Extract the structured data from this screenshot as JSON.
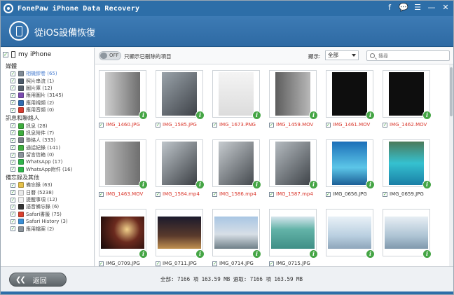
{
  "window": {
    "title": "FonePaw iPhone Data Recovery",
    "title_icons": [
      "facebook-icon",
      "chat-icon",
      "menu-icon",
      "minimize-icon",
      "close-icon"
    ]
  },
  "header": {
    "title": "從iOS設備恢復"
  },
  "sidebar": {
    "device": "my iPhone",
    "groups": [
      {
        "title": "媒體",
        "items": [
          {
            "label": "相機膠卷 (65)",
            "icon": "camera-roll-icon",
            "color": "#7f8a95",
            "active": true
          },
          {
            "label": "照片串流 (1)",
            "icon": "photo-stream-icon",
            "color": "#4b5a6a",
            "active": false
          },
          {
            "label": "圖片庫 (12)",
            "icon": "photo-library-icon",
            "color": "#555f6b",
            "active": false
          },
          {
            "label": "應用圖片 (3145)",
            "icon": "app-photos-icon",
            "color": "#7b4bb0",
            "active": false
          },
          {
            "label": "應用視頻 (2)",
            "icon": "app-videos-icon",
            "color": "#2f6bb0",
            "active": false
          },
          {
            "label": "應用音頻 (0)",
            "icon": "app-audio-icon",
            "color": "#d63b2f",
            "active": false
          }
        ]
      },
      {
        "title": "訊息和聯絡人",
        "items": [
          {
            "label": "訊息 (28)",
            "icon": "messages-icon",
            "color": "#3fae3f",
            "active": false
          },
          {
            "label": "訊息附件 (7)",
            "icon": "message-attachments-icon",
            "color": "#3fae3f",
            "active": false
          },
          {
            "label": "聯絡人 (333)",
            "icon": "contacts-icon",
            "color": "#777f87",
            "active": false
          },
          {
            "label": "通話紀錄 (141)",
            "icon": "call-history-icon",
            "color": "#3fae3f",
            "active": false
          },
          {
            "label": "留言信箱 (0)",
            "icon": "voicemail-icon",
            "color": "#8a939b",
            "active": false
          },
          {
            "label": "WhatsApp (17)",
            "icon": "whatsapp-icon",
            "color": "#2fb54b",
            "active": false
          },
          {
            "label": "WhatsApp附件 (16)",
            "icon": "whatsapp-attachments-icon",
            "color": "#2fb54b",
            "active": false
          }
        ]
      },
      {
        "title": "備忘錄及其他",
        "items": [
          {
            "label": "備忘錄 (63)",
            "icon": "notes-icon",
            "color": "#e6c14a",
            "active": false
          },
          {
            "label": "日曆 (5238)",
            "icon": "calendar-icon",
            "color": "#e9e9e9",
            "active": false
          },
          {
            "label": "提醒事項 (12)",
            "icon": "reminders-icon",
            "color": "#f0f0f0",
            "active": false
          },
          {
            "label": "語音備忘錄 (6)",
            "icon": "voice-memos-icon",
            "color": "#333333",
            "active": false
          },
          {
            "label": "Safari書籤 (75)",
            "icon": "safari-bookmark-icon",
            "color": "#d9412f",
            "active": false
          },
          {
            "label": "Safari History (3)",
            "icon": "safari-history-icon",
            "color": "#3a8fd6",
            "active": false
          },
          {
            "label": "應用檔案 (2)",
            "icon": "app-documents-icon",
            "color": "#8a939b",
            "active": false
          }
        ]
      }
    ]
  },
  "toolbar": {
    "toggle_label": "OFF",
    "toggle_text": "只顯示已刪除的項目",
    "show_label": "顯示:",
    "show_value": "全部",
    "search_placeholder": "搜尋"
  },
  "grid": {
    "rows": [
      [
        {
          "name": "IMG_1460.JPG",
          "deleted": true,
          "tone": "#8f8f8f",
          "fill": "linear-gradient(90deg,#cfcfcf,#6e6e6e)"
        },
        {
          "name": "IMG_1585.JPG",
          "deleted": true,
          "tone": "#6b6b6b",
          "fill": "linear-gradient(135deg,#9aa3aa,#3e4248)"
        },
        {
          "name": "IMG_1673.PNG",
          "deleted": true,
          "tone": "#e9e9e9",
          "fill": "linear-gradient(180deg,#f4f4f4,#dcdcdc)"
        },
        {
          "name": "IMG_1459.MOV",
          "deleted": true,
          "tone": "#777",
          "fill": "linear-gradient(90deg,#5d5d5d,#b8b8b8)"
        },
        {
          "name": "IMG_1461.MOV",
          "deleted": true,
          "tone": "#111",
          "fill": "#0e0e0e"
        },
        {
          "name": "IMG_1462.MOV",
          "deleted": true,
          "tone": "#111",
          "fill": "#0e0e0e"
        }
      ],
      [
        {
          "name": "IMG_1463.MOV",
          "deleted": true,
          "tone": "#999",
          "fill": "linear-gradient(90deg,#b8b8b8,#6f6f6f)"
        },
        {
          "name": "IMG_1584.mp4",
          "deleted": true,
          "tone": "#555",
          "fill": "linear-gradient(135deg,#bfc6cb,#3b3f44)"
        },
        {
          "name": "IMG_1586.mp4",
          "deleted": true,
          "tone": "#666",
          "fill": "linear-gradient(135deg,#c7ccd0,#454a4f)"
        },
        {
          "name": "IMG_1587.mp4",
          "deleted": true,
          "tone": "#666",
          "fill": "linear-gradient(135deg,#b5bbc0,#3f4449)"
        },
        {
          "name": "IMG_0656.JPG",
          "deleted": false,
          "tone": "#2a8fd8",
          "fill": "linear-gradient(180deg,#1c6fb8,#5cc6e8 60%,#1b5f96)"
        },
        {
          "name": "IMG_0659.JPG",
          "deleted": false,
          "tone": "#3bb8c6",
          "fill": "linear-gradient(180deg,#4c7a5a,#35c1d0 50%,#1a7fa6)"
        }
      ],
      [
        {
          "name": "IMG_0709.JPG",
          "deleted": false,
          "tone": "#3a1d1d",
          "fill": "radial-gradient(circle at 60% 40%,#f1d08a,#6b2a1e 40%,#140808)"
        },
        {
          "name": "IMG_0711.JPG",
          "deleted": false,
          "tone": "#2b2436",
          "fill": "linear-gradient(180deg,#1b1a2c,#5a3a2c 60%,#c09050)"
        },
        {
          "name": "IMG_0714.JPG",
          "deleted": false,
          "tone": "#7fa4c8",
          "fill": "linear-gradient(180deg,#a9c6e4,#d7dfe6 55%,#6f7f88)"
        },
        {
          "name": "IMG_0715.JPG",
          "deleted": false,
          "tone": "#6fb0a6",
          "fill": "linear-gradient(180deg,#d7e6ee,#63b3a8 40%,#3f8f86)"
        },
        {
          "name": "",
          "deleted": false,
          "tone": "#c8d8e6",
          "fill": "linear-gradient(180deg,#e9f1f7,#b9cfe0 60%,#8ea6bb)"
        },
        {
          "name": "",
          "deleted": false,
          "tone": "#c0d0dc",
          "fill": "linear-gradient(180deg,#e7eef4,#aec4d4 60%,#8099ad)"
        }
      ]
    ]
  },
  "footer": {
    "back_label": "返回",
    "status": "全部: 7166 項 163.59 MB 選取: 7166 項 163.59 MB"
  }
}
